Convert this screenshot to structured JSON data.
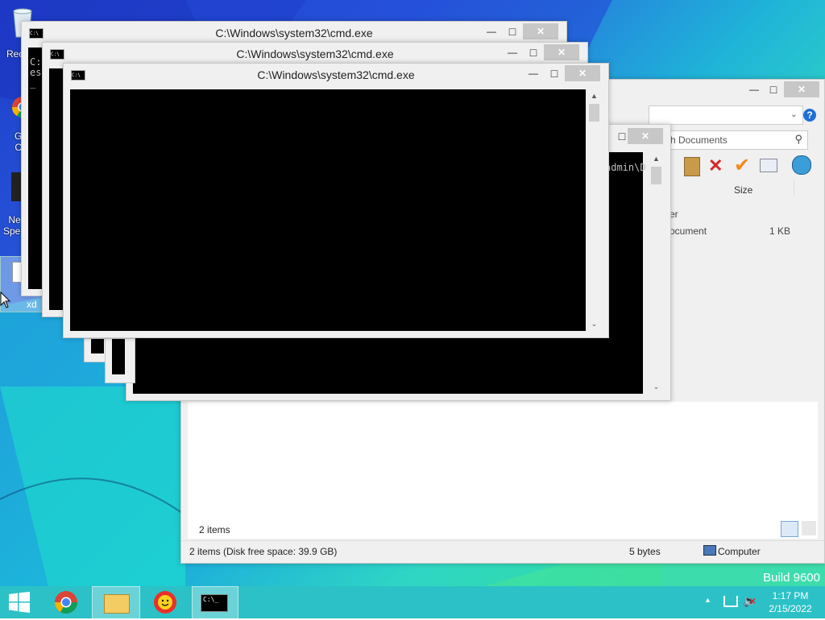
{
  "desktop": {
    "icons": [
      {
        "label": "Rec"
      },
      {
        "label": "G\nC"
      },
      {
        "label": "Ne\nSpee"
      },
      {
        "label": "xd"
      }
    ],
    "build_label": "Build 9600"
  },
  "cmd_windows": [
    {
      "title": "C:\\Windows\\system32\\cmd.exe",
      "console_text": "C:\nes\n_"
    },
    {
      "title": "C:\\Windows\\system32\\cmd.exe",
      "console_text": ""
    },
    {
      "title": "C:\\Windows\\system32\\cmd.exe",
      "console_text": ""
    }
  ],
  "cmd_back": {
    "console_text": "admin\\D"
  },
  "explorer": {
    "search_placeholder": "ch Documents",
    "column_size": "Size",
    "rows": [
      {
        "type": "er",
        "size": ""
      },
      {
        "type": "ocument",
        "size": "1 KB"
      }
    ],
    "items_count": "2 items",
    "status_left": "2 items (Disk free space: 39.9 GB)",
    "status_size": "5 bytes",
    "status_location": "Computer"
  },
  "controls": {
    "minimize": "—",
    "maximize": "□",
    "close": "✕",
    "help": "?"
  },
  "taskbar": {
    "apps": [
      {
        "name": "start"
      },
      {
        "name": "chrome"
      },
      {
        "name": "file-explorer"
      },
      {
        "name": "sun-app"
      },
      {
        "name": "cmd"
      }
    ],
    "time": "1:17 PM",
    "date": "2/15/2022",
    "console_icon_text": "C:\\_"
  },
  "colors": {
    "taskbar": "#2cc1c6",
    "close_button": "#c7c7c7",
    "console_bg": "#000000"
  }
}
